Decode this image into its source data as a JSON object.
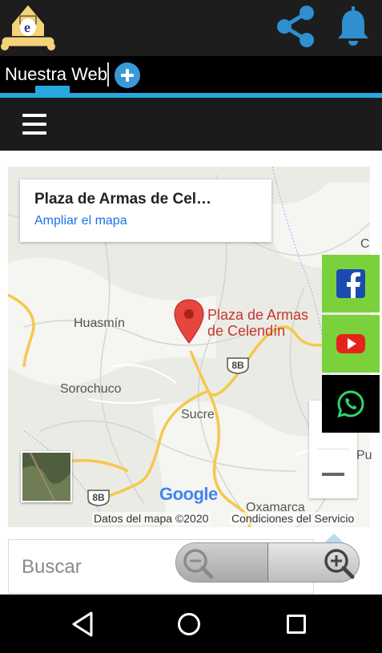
{
  "header": {
    "logo_icon": "app-logo",
    "share_icon": "share-icon",
    "notifications_icon": "bell-icon",
    "accent_color": "#29a8e0"
  },
  "tabs": {
    "active_label": "Nuestra Web",
    "add_icon": "plus-icon"
  },
  "menu": {
    "icon": "hamburger-menu-icon"
  },
  "map": {
    "place_card": {
      "title": "Plaza de Armas de Cel…",
      "link": "Ampliar el mapa"
    },
    "marker_label_line1": "Plaza de Armas",
    "marker_label_line2": "de Celendín",
    "towns": [
      "Huasmín",
      "Sorochuco",
      "Sucre",
      "Oxamarca"
    ],
    "edge_labels": [
      "C",
      "Pu"
    ],
    "route_shields": [
      "8B",
      "8B"
    ],
    "google_logo": "Google",
    "credit": "Datos del mapa ©2020",
    "terms": "Condiciones del Servicio",
    "marker_color": "#e8453c"
  },
  "social": {
    "facebook_icon": "facebook-icon",
    "youtube_icon": "youtube-icon",
    "whatsapp_icon": "whatsapp-icon",
    "panel_color": "#7bd13c"
  },
  "search": {
    "placeholder": "Buscar"
  },
  "page_zoom": {
    "zoom_out_icon": "zoom-out-icon",
    "zoom_in_icon": "zoom-in-icon"
  },
  "navigation": {
    "back_icon": "back-triangle-icon",
    "home_icon": "home-circle-icon",
    "recent_icon": "recent-apps-icon"
  }
}
